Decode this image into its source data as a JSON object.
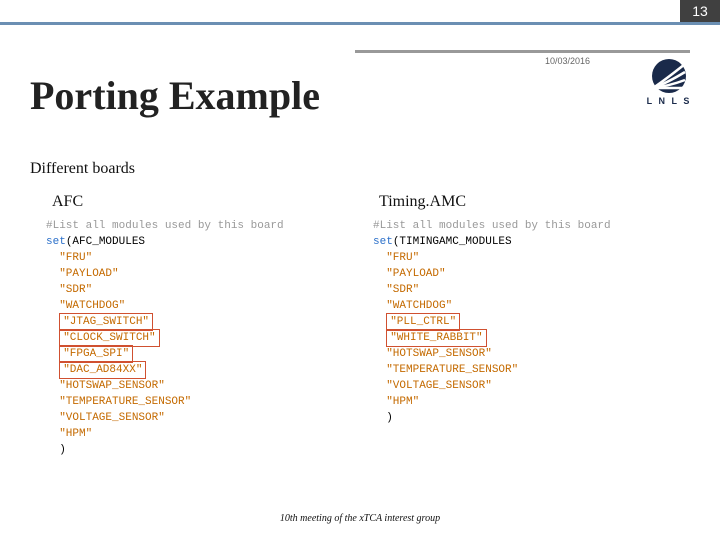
{
  "page_number": "13",
  "date": "10/03/2016",
  "logo": {
    "text": "L N L S",
    "sub": ""
  },
  "title": "Porting Example",
  "subtitle": "Different boards",
  "columns": {
    "left": {
      "label": "AFC",
      "comment": "#List all modules used by this board",
      "set_kw": "set",
      "set_arg": "(AFC_MODULES",
      "items": [
        {
          "text": "\"FRU\"",
          "boxed": false
        },
        {
          "text": "\"PAYLOAD\"",
          "boxed": false
        },
        {
          "text": "\"SDR\"",
          "boxed": false
        },
        {
          "text": "\"WATCHDOG\"",
          "boxed": false
        },
        {
          "text": "\"JTAG_SWITCH\"",
          "boxed": true
        },
        {
          "text": "\"CLOCK_SWITCH\"",
          "boxed": true
        },
        {
          "text": "\"FPGA_SPI\"",
          "boxed": true
        },
        {
          "text": "\"DAC_AD84XX\"",
          "boxed": true
        },
        {
          "text": "\"HOTSWAP_SENSOR\"",
          "boxed": false
        },
        {
          "text": "\"TEMPERATURE_SENSOR\"",
          "boxed": false
        },
        {
          "text": "\"VOLTAGE_SENSOR\"",
          "boxed": false
        },
        {
          "text": "\"HPM\"",
          "boxed": false
        }
      ],
      "close": ")"
    },
    "right": {
      "label": "Timing.AMC",
      "comment": "#List all modules used by this board",
      "set_kw": "set",
      "set_arg": "(TIMINGAMC_MODULES",
      "items": [
        {
          "text": "\"FRU\"",
          "boxed": false
        },
        {
          "text": "\"PAYLOAD\"",
          "boxed": false
        },
        {
          "text": "\"SDR\"",
          "boxed": false
        },
        {
          "text": "\"WATCHDOG\"",
          "boxed": false
        },
        {
          "text": "\"PLL_CTRL\"",
          "boxed": true
        },
        {
          "text": "\"WHITE_RABBIT\"",
          "boxed": true
        },
        {
          "text": "\"HOTSWAP_SENSOR\"",
          "boxed": false
        },
        {
          "text": "\"TEMPERATURE_SENSOR\"",
          "boxed": false
        },
        {
          "text": "\"VOLTAGE_SENSOR\"",
          "boxed": false
        },
        {
          "text": "\"HPM\"",
          "boxed": false
        }
      ],
      "close": ")"
    }
  },
  "footer": "10th meeting of the xTCA interest group"
}
